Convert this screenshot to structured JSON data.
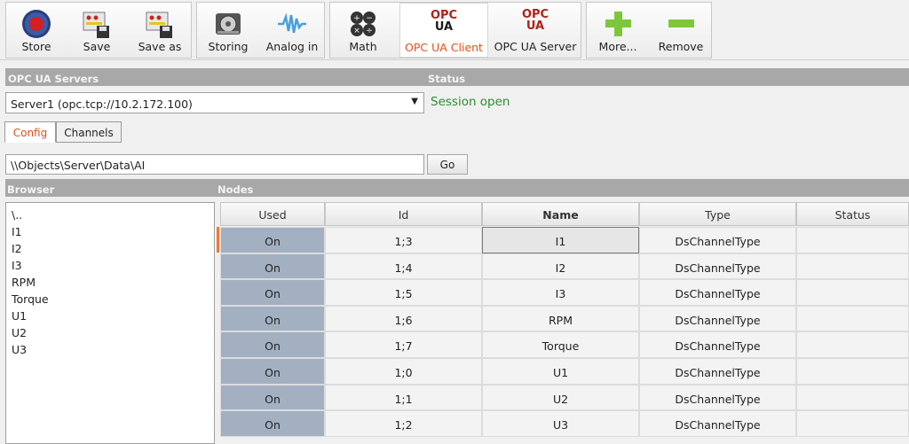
{
  "toolbar": {
    "store": "Store",
    "save": "Save",
    "save_as": "Save as",
    "storing": "Storing",
    "analog_in": "Analog in",
    "math": "Math",
    "opc_client": "OPC UA Client",
    "opc_server": "OPC UA Server",
    "more": "More...",
    "remove": "Remove",
    "opc_logo_top": "OPC",
    "opc_logo_bottom": "UA"
  },
  "servers_header": "OPC UA Servers",
  "status_header": "Status",
  "server_select": "Server1 (opc.tcp://10.2.172.100)",
  "status_value": "Session open",
  "tabs": [
    "Config",
    "Channels"
  ],
  "path_value": "\\\\Objects\\Server\\Data\\AI",
  "go_label": "Go",
  "browser_header": "Browser",
  "nodes_header": "Nodes",
  "browser_items": [
    "\\..",
    "I1",
    "I2",
    "I3",
    "RPM",
    "Torque",
    "U1",
    "U2",
    "U3"
  ],
  "columns": [
    "Used",
    "Id",
    "Name",
    "Type",
    "Status"
  ],
  "rows": [
    {
      "used": "On",
      "id": "1;3",
      "name": "I1",
      "type": "DsChannelType",
      "status": ""
    },
    {
      "used": "On",
      "id": "1;4",
      "name": "I2",
      "type": "DsChannelType",
      "status": ""
    },
    {
      "used": "On",
      "id": "1;5",
      "name": "I3",
      "type": "DsChannelType",
      "status": ""
    },
    {
      "used": "On",
      "id": "1;6",
      "name": "RPM",
      "type": "DsChannelType",
      "status": ""
    },
    {
      "used": "On",
      "id": "1;7",
      "name": "Torque",
      "type": "DsChannelType",
      "status": ""
    },
    {
      "used": "On",
      "id": "1;0",
      "name": "U1",
      "type": "DsChannelType",
      "status": ""
    },
    {
      "used": "On",
      "id": "1;1",
      "name": "U2",
      "type": "DsChannelType",
      "status": ""
    },
    {
      "used": "On",
      "id": "1;2",
      "name": "U3",
      "type": "DsChannelType",
      "status": ""
    }
  ],
  "colors": {
    "accent": "#e0501a",
    "status_ok": "#2e8b2e",
    "used_cell": "#a3b0c2"
  }
}
